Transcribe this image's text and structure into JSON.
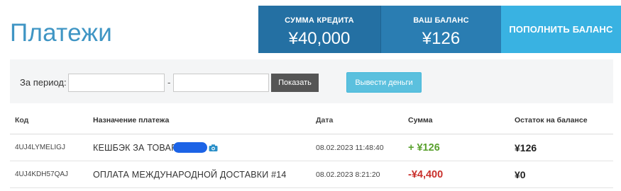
{
  "header": {
    "title": "Платежи",
    "credit": {
      "label": "СУММА КРЕДИТА",
      "value": "¥40,000"
    },
    "balance": {
      "label": "ВАШ БАЛАНС",
      "value": "¥126"
    },
    "topup_label": "ПОПОЛНИТЬ БАЛАНС",
    "colors": {
      "credit_bg": "#2470a3",
      "balance_bg": "#2a7db2",
      "topup_bg": "#39b2e2",
      "title": "#3f95c4"
    }
  },
  "filter": {
    "period_label": "За период:",
    "date_from": "",
    "date_to": "",
    "dash": "-",
    "show_label": "Показать",
    "withdraw_label": "Вывести деньги"
  },
  "table": {
    "columns": [
      "Код",
      "Назначение платежа",
      "Дата",
      "Сумма",
      "Остаток на балансе"
    ],
    "rows": [
      {
        "code": "4UJ4LYMELIGJ",
        "purpose": "КЕШБЭК ЗА ТОВАР",
        "purpose_icon": "camera-icon",
        "date": "08.02.2023 11:48:40",
        "amount": "+ ¥126",
        "amount_color": "#5aa12e",
        "rest": "¥126"
      },
      {
        "code": "4UJ4KDH57QAJ",
        "purpose": "ОПЛАТА МЕЖДУНАРОДНОЙ ДОСТАВКИ #14",
        "date": "08.02.2023 8:21:20",
        "amount": "-¥4,400",
        "amount_color": "#c9302c",
        "rest": "¥0"
      }
    ]
  }
}
